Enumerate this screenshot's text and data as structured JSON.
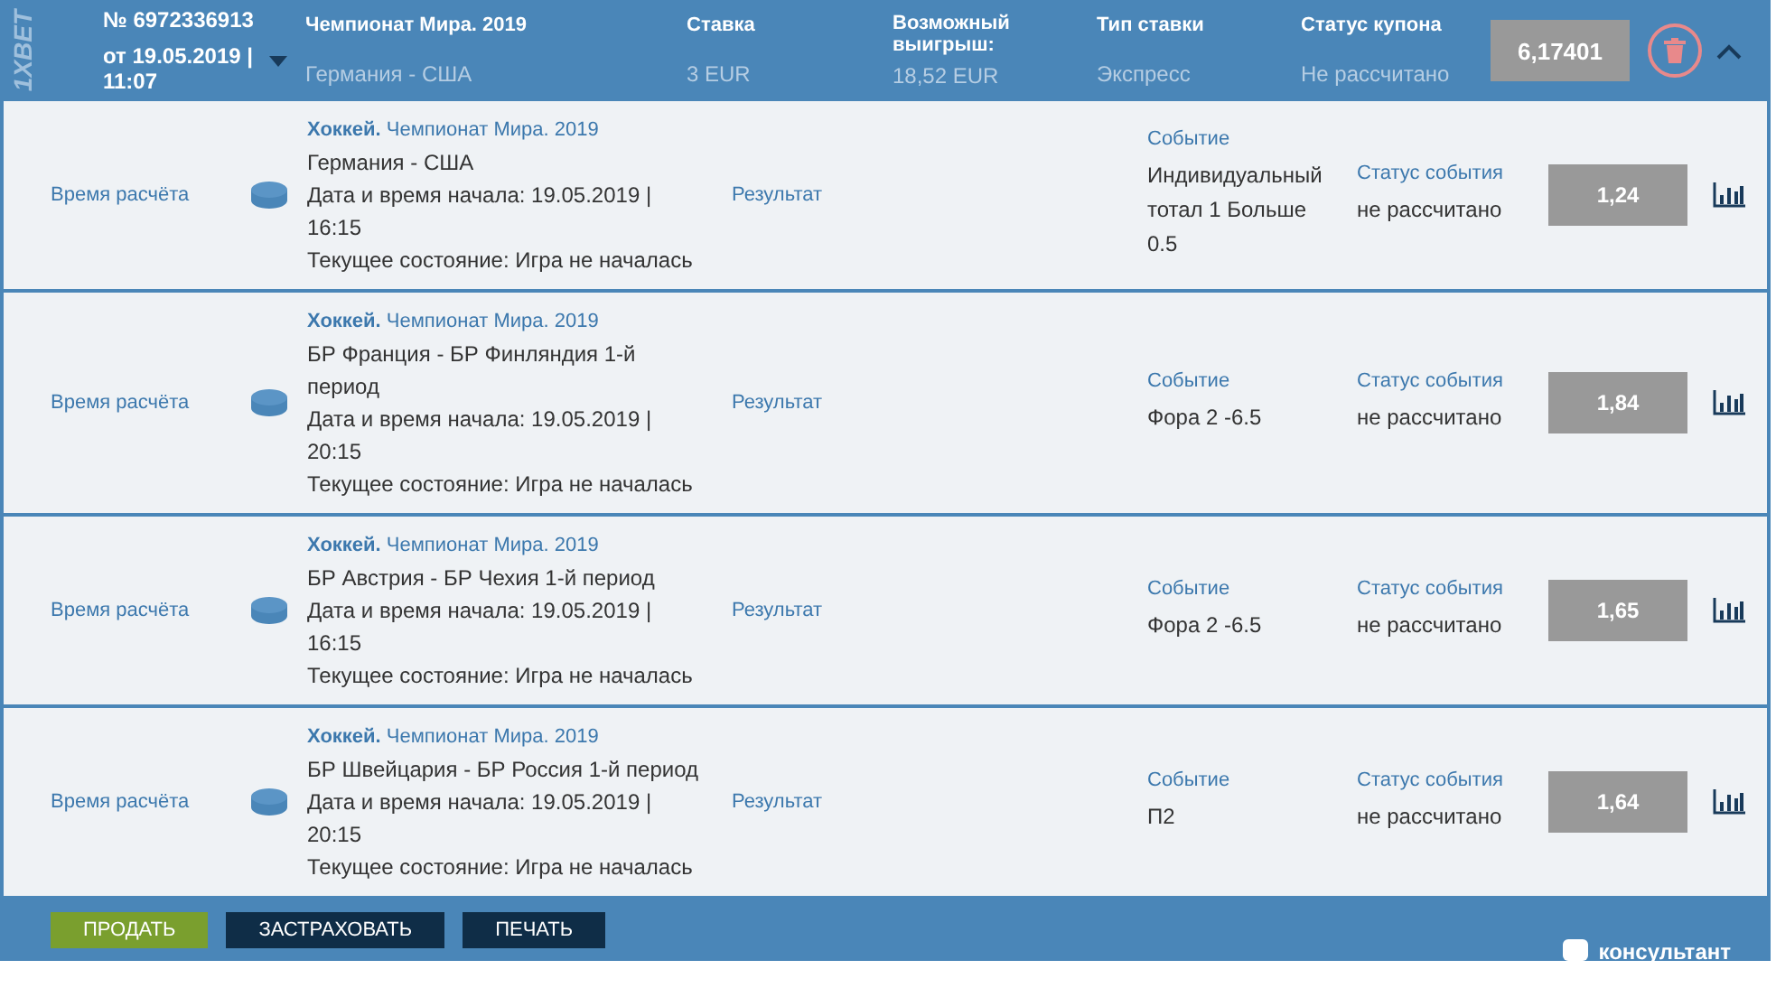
{
  "header": {
    "logo": "1XBET",
    "number": "№ 6972336913",
    "date": "от 19.05.2019 | 11:07",
    "columns": [
      {
        "label": "Чемпионат Мира. 2019",
        "value": "Германия - США"
      },
      {
        "label": "Ставка",
        "value": "3 EUR"
      },
      {
        "label": "Возможный выигрыш:",
        "value": "18,52 EUR"
      },
      {
        "label": "Тип ставки",
        "value": "Экспресс"
      },
      {
        "label": "Статус купона",
        "value": "Не рассчитано"
      }
    ],
    "total_odds": "6,17401",
    "expanded": true
  },
  "events": [
    {
      "settle_label": "Время расчёта",
      "sport": "Хоккей.",
      "league": "Чемпионат Мира. 2019",
      "match": "Германия - США",
      "start": "Дата и время начала: 19.05.2019 | 16:15",
      "state": "Текущее состояние: Игра не началась",
      "result_label": "Результат",
      "event_label": "Событие",
      "event": "Индивидуальный тотал 1 Больше 0.5",
      "status_label": "Статус события",
      "status": "не рассчитано",
      "odds": "1,24"
    },
    {
      "settle_label": "Время расчёта",
      "sport": "Хоккей.",
      "league": "Чемпионат Мира. 2019",
      "match": "БР Франция - БР Финляндия 1-й период",
      "start": "Дата и время начала: 19.05.2019 | 20:15",
      "state": "Текущее состояние: Игра не началась",
      "result_label": "Результат",
      "event_label": "Событие",
      "event": "Фора 2 -6.5",
      "status_label": "Статус события",
      "status": "не рассчитано",
      "odds": "1,84"
    },
    {
      "settle_label": "Время расчёта",
      "sport": "Хоккей.",
      "league": "Чемпионат Мира. 2019",
      "match": "БР Австрия - БР Чехия 1-й период",
      "start": "Дата и время начала: 19.05.2019 | 16:15",
      "state": "Текущее состояние: Игра не началась",
      "result_label": "Результат",
      "event_label": "Событие",
      "event": "Фора 2 -6.5",
      "status_label": "Статус события",
      "status": "не рассчитано",
      "odds": "1,65"
    },
    {
      "settle_label": "Время расчёта",
      "sport": "Хоккей.",
      "league": "Чемпионат Мира. 2019",
      "match": "БР Швейцария - БР Россия 1-й период",
      "start": "Дата и время начала: 19.05.2019 | 20:15",
      "state": "Текущее состояние: Игра не началась",
      "result_label": "Результат",
      "event_label": "Событие",
      "event": "П2",
      "status_label": "Статус события",
      "status": "не рассчитано",
      "odds": "1,64"
    }
  ],
  "footer": {
    "buttons": [
      {
        "label": "ПРОДАТЬ",
        "kind": "primary"
      },
      {
        "label": "ЗАСТРАХОВАТЬ",
        "kind": "dark"
      },
      {
        "label": "ПЕЧАТЬ",
        "kind": "dark"
      }
    ],
    "chat": "консультант"
  }
}
